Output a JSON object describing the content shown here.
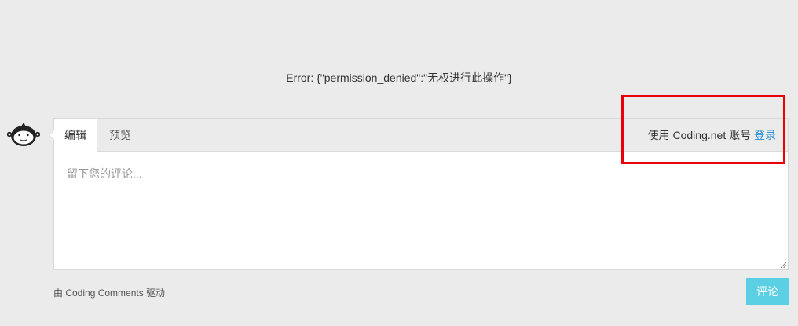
{
  "error": {
    "text": "Error: {\"permission_denied\":\"无权进行此操作\"}"
  },
  "avatar": {
    "icon": "monkey-avatar-icon"
  },
  "editor": {
    "tabs": [
      {
        "label": "编辑",
        "active": true
      },
      {
        "label": "预览",
        "active": false
      }
    ],
    "login_prefix": "使用 Coding.net 账号",
    "login_link": "登录",
    "comment_placeholder": "留下您的评论...",
    "comment_value": ""
  },
  "footer": {
    "powered_by": "由 Coding Comments 驱动",
    "submit_label": "评论"
  },
  "colors": {
    "background": "#ebebeb",
    "link": "#2a8fd6",
    "submit_button": "#5bcfe4",
    "highlight_box": "#e8000b"
  }
}
